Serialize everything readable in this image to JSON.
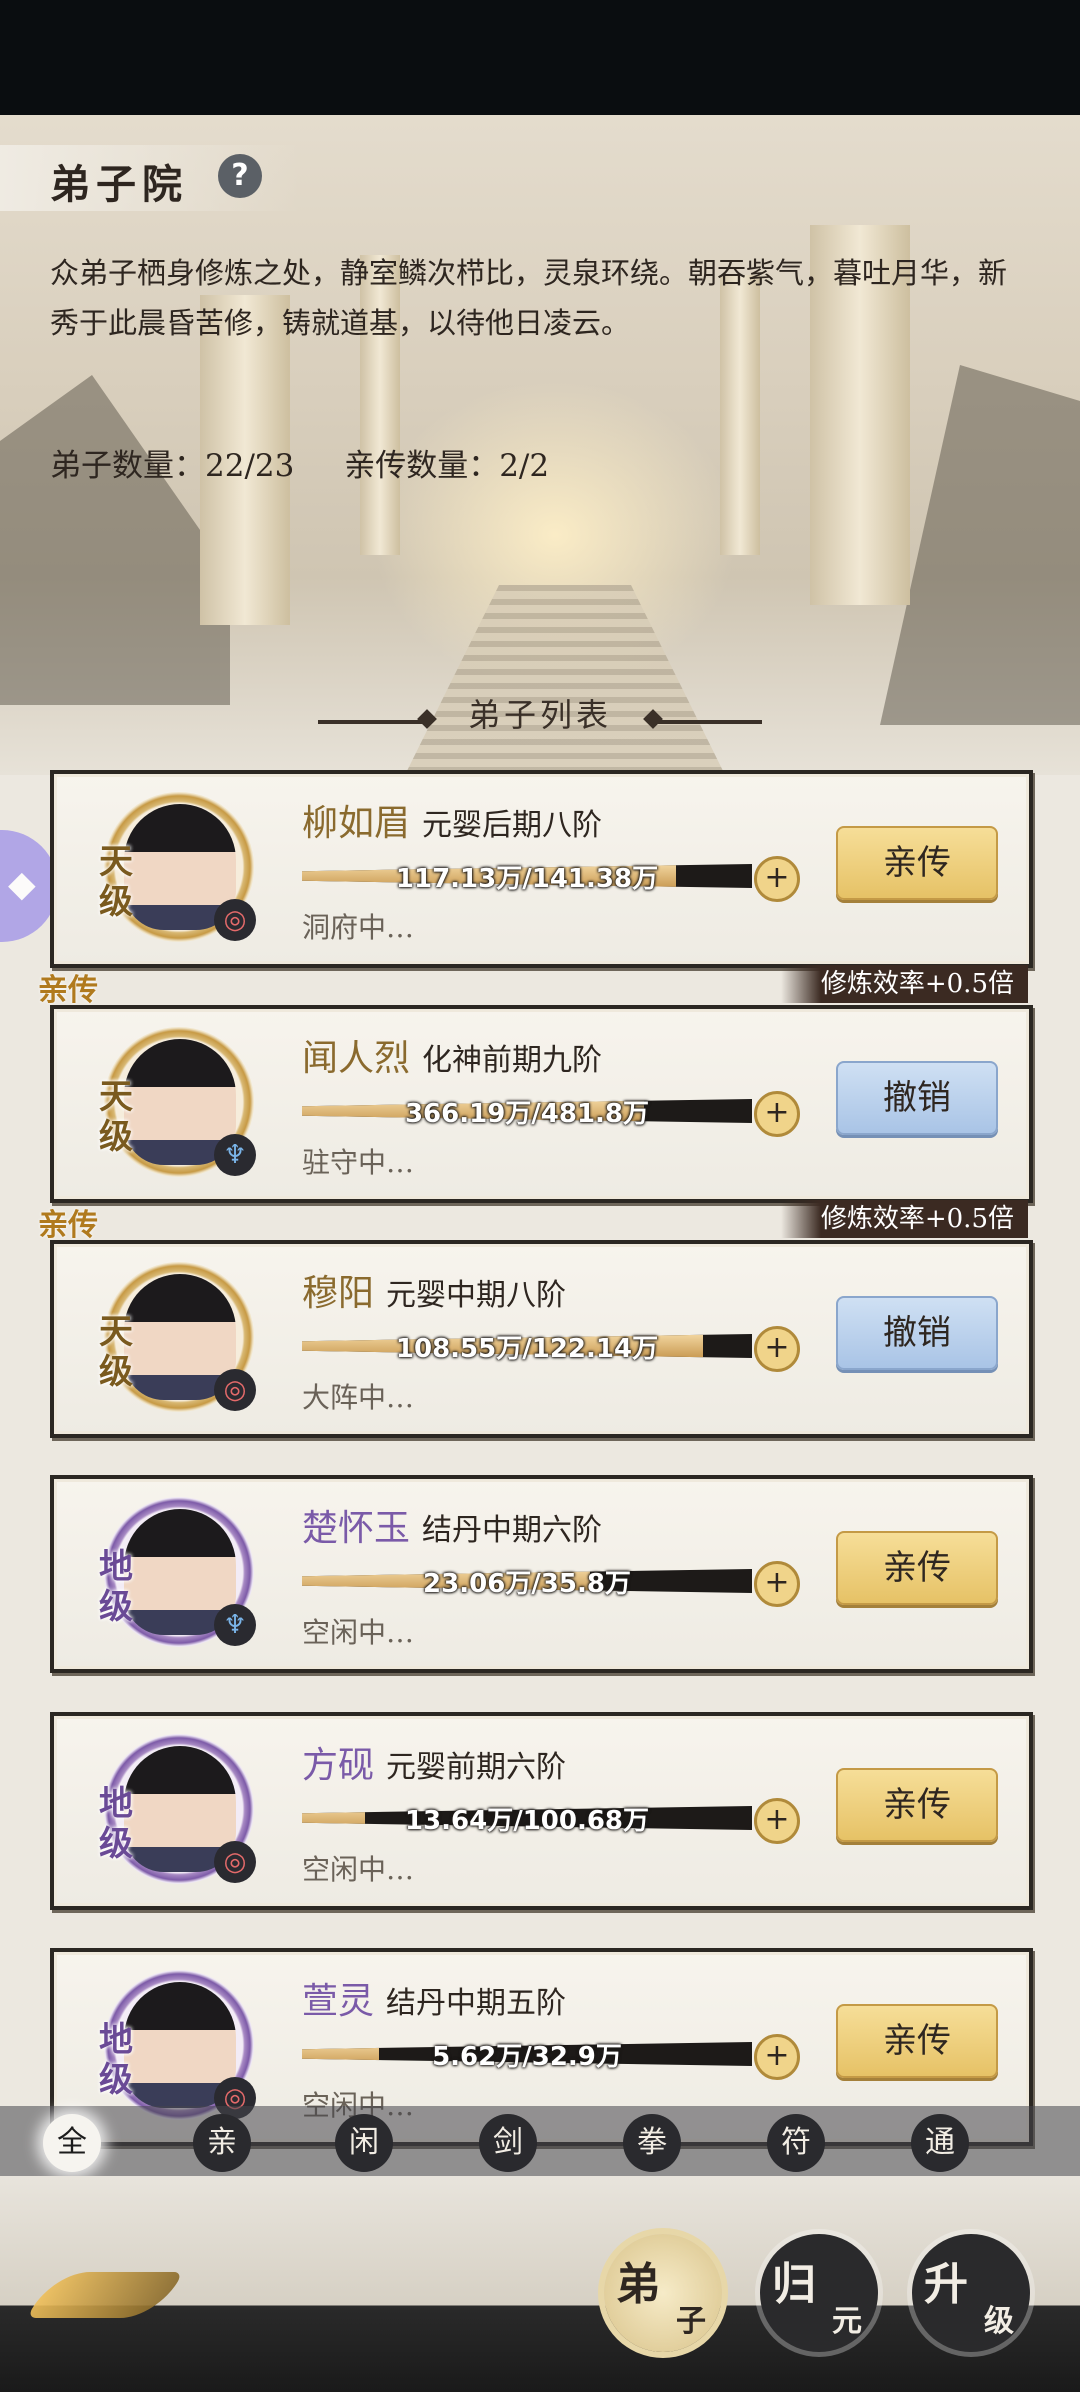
{
  "header": {
    "title": "弟子院",
    "help_icon": "question-mark-icon",
    "description": "众弟子栖身修炼之处，静室鳞次栉比，灵泉环绕。朝吞紫气，暮吐月华，新秀于此晨昏苦修，铸就道基，以待他日凌云。",
    "disciple_count_label": "弟子数量：22/23",
    "personal_count_label": "亲传数量：2/2"
  },
  "list_title": "弟子列表",
  "disciples": [
    {
      "grade": "天级",
      "name": "柳如眉",
      "realm": "元婴后期八阶",
      "progress": "117.13万/141.38万",
      "progress_fraction": 0.83,
      "status": "洞府中…",
      "action": "亲传",
      "element_icon": "fire-swirl-icon",
      "is_personal": false,
      "bonus": ""
    },
    {
      "grade": "天级",
      "name": "闻人烈",
      "realm": "化神前期九阶",
      "progress": "366.19万/481.8万",
      "progress_fraction": 0.76,
      "status": "驻守中…",
      "action": "撤销",
      "element_icon": "water-crest-icon",
      "is_personal": true,
      "personal_tag": "亲传",
      "bonus": "修炼效率+0.5倍"
    },
    {
      "grade": "天级",
      "name": "穆阳",
      "realm": "元婴中期八阶",
      "progress": "108.55万/122.14万",
      "progress_fraction": 0.89,
      "status": "大阵中…",
      "action": "撤销",
      "element_icon": "fire-swirl-icon",
      "is_personal": true,
      "personal_tag": "亲传",
      "bonus": "修炼效率+0.5倍"
    },
    {
      "grade": "地级",
      "name": "楚怀玉",
      "realm": "结丹中期六阶",
      "progress": "23.06万/35.8万",
      "progress_fraction": 0.64,
      "status": "空闲中…",
      "action": "亲传",
      "element_icon": "water-crest-icon",
      "is_personal": false,
      "bonus": ""
    },
    {
      "grade": "地级",
      "name": "方砚",
      "realm": "元婴前期六阶",
      "progress": "13.64万/100.68万",
      "progress_fraction": 0.14,
      "status": "空闲中…",
      "action": "亲传",
      "element_icon": "fire-swirl-icon",
      "is_personal": false,
      "bonus": ""
    },
    {
      "grade": "地级",
      "name": "萱灵",
      "realm": "结丹中期五阶",
      "progress": "5.62万/32.9万",
      "progress_fraction": 0.17,
      "status": "空闲中…",
      "action": "亲传",
      "element_icon": "fire-swirl-icon",
      "is_personal": false,
      "bonus": ""
    }
  ],
  "filters": [
    {
      "label": "全",
      "active": true
    },
    {
      "label": "亲",
      "active": false
    },
    {
      "label": "闲",
      "active": false
    },
    {
      "label": "剑",
      "active": false
    },
    {
      "label": "拳",
      "active": false
    },
    {
      "label": "符",
      "active": false
    },
    {
      "label": "通",
      "active": false
    }
  ],
  "bottom_nav": [
    {
      "big": "弟",
      "small": "子",
      "active": true
    },
    {
      "big": "归",
      "small": "元",
      "active": false
    },
    {
      "big": "升",
      "small": "级",
      "active": false
    }
  ],
  "floating_button_icon": "gamepad-icon",
  "colors": {
    "gold_button": "#e6c266",
    "blue_button": "#a9c4e6",
    "heaven_name": "#8a6a2e",
    "earth_name": "#7a5aa8",
    "personal_tag": "#b07a1e"
  }
}
